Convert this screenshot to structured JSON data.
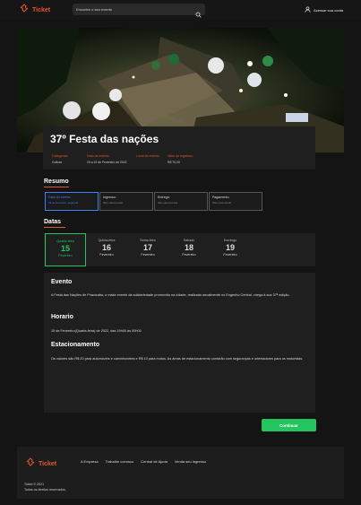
{
  "header": {
    "logo_text": "Ticket",
    "search_placeholder": "Encontre o seu evento",
    "account_label": "Acessar sua conta"
  },
  "event": {
    "title": "37º Festa das nações",
    "fields": [
      {
        "label": "Categorias:",
        "value": "Cultura"
      },
      {
        "label": "Data do evento:",
        "value": "15 a 19 de Fevereiro de 2022"
      },
      {
        "label": "Local do evento:",
        "value": ""
      },
      {
        "label": "Valor do ingresso:",
        "value": "R$ 70,00"
      }
    ]
  },
  "summary": {
    "title": "Resumo",
    "steps": [
      {
        "label": "Data do evento:",
        "value": "15 de fevereiro, segunda"
      },
      {
        "label": "Ingresso:",
        "value": "Não selecionado"
      },
      {
        "label": "Entrega:",
        "value": "Não selecionada"
      },
      {
        "label": "Pagamento:",
        "value": "Não preenchido"
      }
    ]
  },
  "dates": {
    "title": "Datas",
    "items": [
      {
        "weekday": "Quarta-feira",
        "day": "15",
        "month": "Fevereiro"
      },
      {
        "weekday": "Quinta-feira",
        "day": "16",
        "month": "Fevereiro"
      },
      {
        "weekday": "Sexta-feira",
        "day": "17",
        "month": "Fevereiro"
      },
      {
        "weekday": "Sábado",
        "day": "18",
        "month": "Fevereiro"
      },
      {
        "weekday": "Domingo",
        "day": "19",
        "month": "Fevereiro"
      }
    ]
  },
  "details": {
    "event_heading": "Evento",
    "event_text": "A Festa das Nações de Piracicaba, o maior evento da solidariedade promovido na cidade, realizado anualmente no Engenho Central, chega à sua 37ª edição.",
    "schedule_heading": "Horario",
    "schedule_text": "15 de Fevereiro(Quarta-feira) de 2022, das 19h00 às 00h00",
    "parking_heading": "Estacionamento",
    "parking_text": "Os valores      são R$ 20 para automóveis e caminhonetes e R$ 10 para motos. As áreas de estacionamento contarão com seguranças e orientadores para os motoristas."
  },
  "actions": {
    "continue_label": "Continuar"
  },
  "footer": {
    "logo_text": "Ticket",
    "links": [
      "A Empresa",
      "Trabalhe conosco",
      "Central de Ajuda",
      "Venda seu ingresso"
    ],
    "copyright": "Ticket © 2021",
    "rights": "Todos os direitos reservados."
  },
  "colors": {
    "accent": "#e4572e",
    "selected": "#22c55e",
    "active_step": "#3b82f6",
    "background": "#141414",
    "card": "#1f1f1f"
  }
}
